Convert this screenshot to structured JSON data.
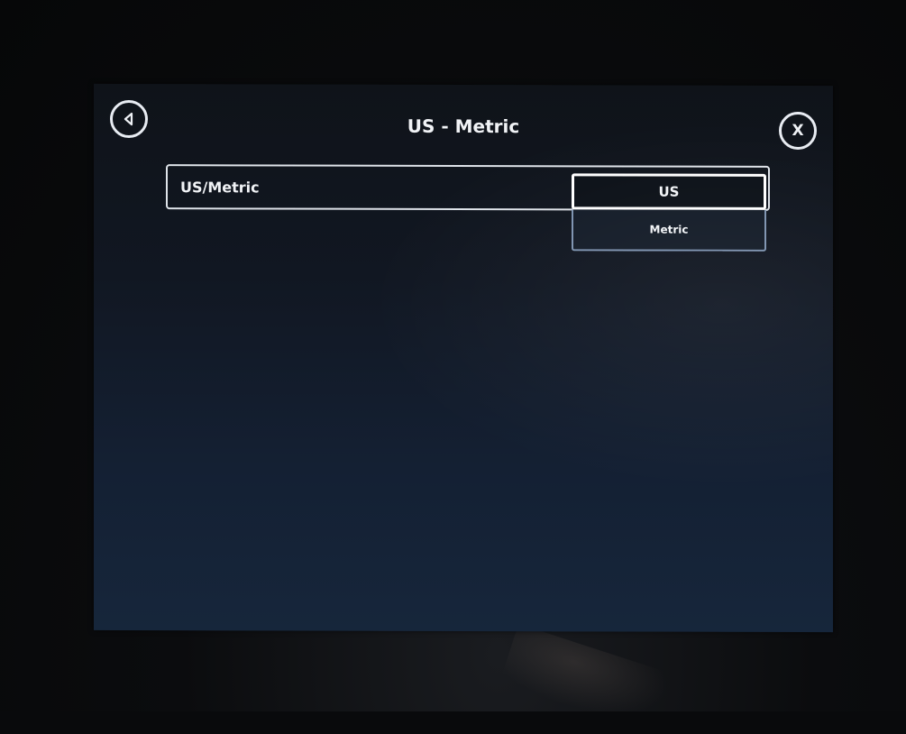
{
  "header": {
    "title": "US - Metric",
    "back_icon": "back-arrow-icon",
    "close_icon": "close-icon",
    "close_glyph": "X"
  },
  "setting": {
    "label": "US/Metric",
    "selected": "US",
    "options": [
      "US",
      "Metric"
    ]
  },
  "colors": {
    "screen_background": "#111722",
    "text": "#f1f3f6",
    "outline": "#dfe4ea",
    "option_border": "#7e93b0"
  }
}
